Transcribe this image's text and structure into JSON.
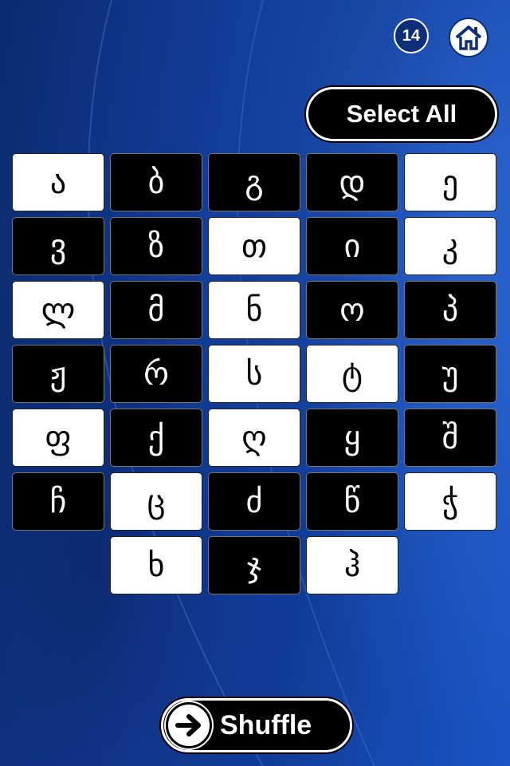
{
  "header": {
    "count_badge": "14",
    "home_icon": "home-icon"
  },
  "buttons": {
    "select_all": "Select All",
    "shuffle": "Shuffle",
    "shuffle_icon": "arrow-right-icon"
  },
  "colors": {
    "background": "#123f9c",
    "tile_selected": "#000000",
    "tile_unselected": "#ffffff"
  },
  "grid": {
    "rows": [
      [
        {
          "letter": "ა",
          "state": "white"
        },
        {
          "letter": "ბ",
          "state": "black"
        },
        {
          "letter": "გ",
          "state": "black"
        },
        {
          "letter": "დ",
          "state": "black"
        },
        {
          "letter": "ე",
          "state": "white"
        }
      ],
      [
        {
          "letter": "ვ",
          "state": "black"
        },
        {
          "letter": "ზ",
          "state": "black"
        },
        {
          "letter": "თ",
          "state": "white"
        },
        {
          "letter": "ი",
          "state": "black"
        },
        {
          "letter": "კ",
          "state": "white"
        }
      ],
      [
        {
          "letter": "ლ",
          "state": "white"
        },
        {
          "letter": "მ",
          "state": "black"
        },
        {
          "letter": "ნ",
          "state": "white"
        },
        {
          "letter": "ო",
          "state": "black"
        },
        {
          "letter": "პ",
          "state": "black"
        }
      ],
      [
        {
          "letter": "ჟ",
          "state": "black"
        },
        {
          "letter": "რ",
          "state": "black"
        },
        {
          "letter": "ს",
          "state": "white"
        },
        {
          "letter": "ტ",
          "state": "white"
        },
        {
          "letter": "უ",
          "state": "black"
        }
      ],
      [
        {
          "letter": "ფ",
          "state": "white"
        },
        {
          "letter": "ქ",
          "state": "black"
        },
        {
          "letter": "ღ",
          "state": "white"
        },
        {
          "letter": "ყ",
          "state": "black"
        },
        {
          "letter": "შ",
          "state": "black"
        }
      ],
      [
        {
          "letter": "ჩ",
          "state": "black"
        },
        {
          "letter": "ც",
          "state": "white"
        },
        {
          "letter": "ძ",
          "state": "black"
        },
        {
          "letter": "წ",
          "state": "black"
        },
        {
          "letter": "ჭ",
          "state": "white"
        }
      ],
      [
        {
          "letter": "ხ",
          "state": "white"
        },
        {
          "letter": "ჯ",
          "state": "black"
        },
        {
          "letter": "ჰ",
          "state": "white"
        }
      ]
    ]
  }
}
